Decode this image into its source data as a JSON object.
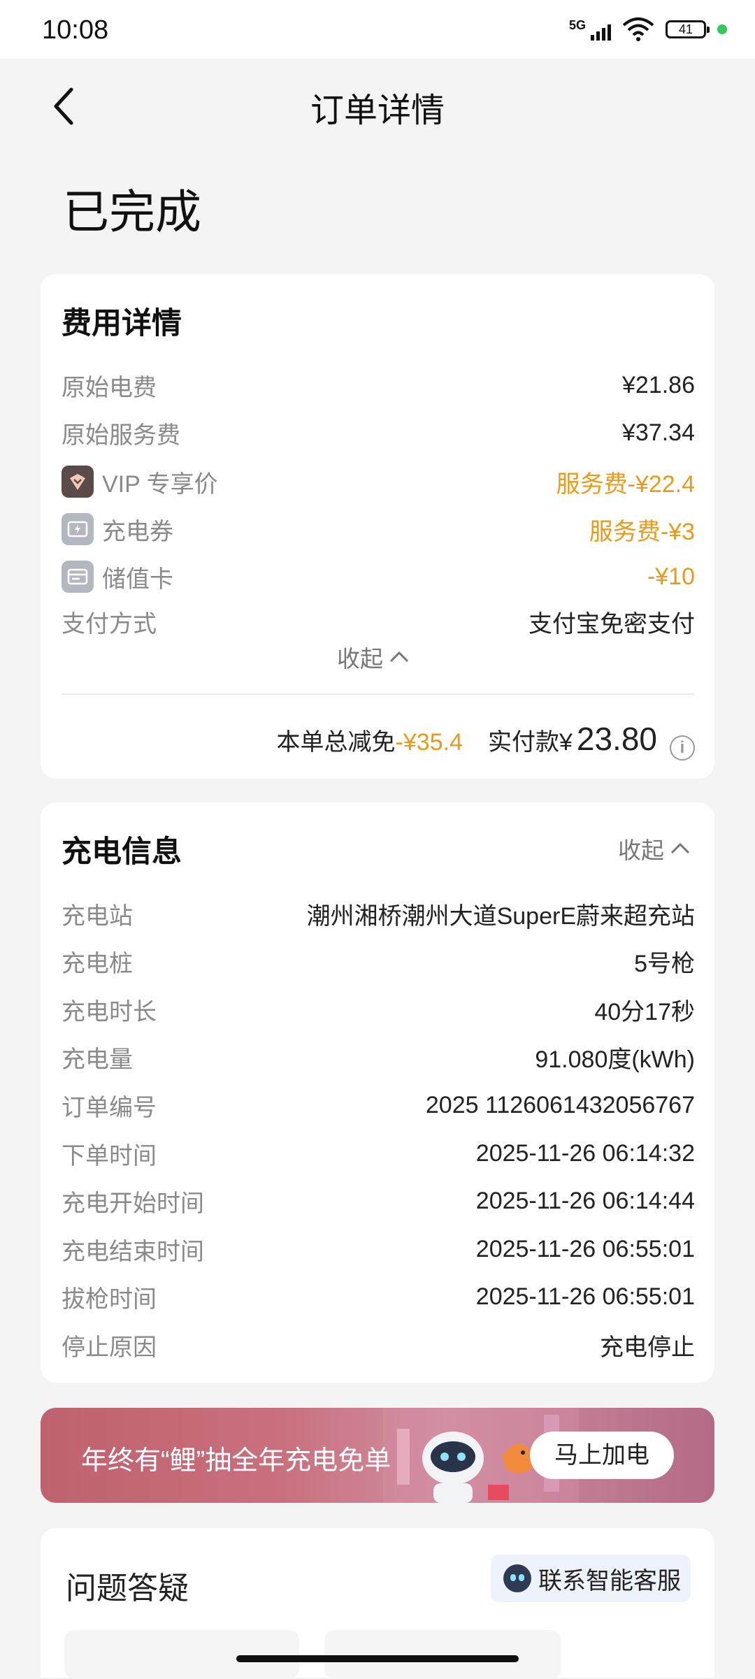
{
  "status_bar": {
    "time": "10:08",
    "network": "5G",
    "battery": "41"
  },
  "header": {
    "title": "订单详情"
  },
  "order_status": "已完成",
  "fees": {
    "title": "费用详情",
    "rows": [
      {
        "label": "原始电费",
        "value": "¥21.86"
      },
      {
        "label": "原始服务费",
        "value": "¥37.34"
      },
      {
        "label": "VIP 专享价",
        "value": "服务费-¥22.4",
        "icon": "vip-icon"
      },
      {
        "label": "充电券",
        "value": "服务费-¥3",
        "icon": "coupon-icon"
      },
      {
        "label": "储值卡",
        "value": "-¥10",
        "icon": "card-icon"
      },
      {
        "label": "支付方式",
        "value": "支付宝免密支付"
      }
    ],
    "collapse_label": "收起",
    "total_discount_label": "本单总减免",
    "total_discount_value": "-¥35.4",
    "paid_label": "实付款¥",
    "paid_value": "23.80"
  },
  "charging": {
    "title": "充电信息",
    "collapse_label": "收起",
    "rows": [
      {
        "label": "充电站",
        "value": "潮州湘桥潮州大道SuperE蔚来超充站"
      },
      {
        "label": "充电桩",
        "value": "5号枪"
      },
      {
        "label": "充电时长",
        "value": "40分17秒"
      },
      {
        "label": "充电量",
        "value": "91.080度(kWh)"
      },
      {
        "label": "订单编号",
        "value": "2025 1126061432056767"
      },
      {
        "label": "下单时间",
        "value": "2025-11-26 06:14:32"
      },
      {
        "label": "充电开始时间",
        "value": "2025-11-26 06:14:44"
      },
      {
        "label": "充电结束时间",
        "value": "2025-11-26 06:55:01"
      },
      {
        "label": "拔枪时间",
        "value": "2025-11-26 06:55:01"
      },
      {
        "label": "停止原因",
        "value": "充电停止"
      }
    ]
  },
  "banner": {
    "text": "年终有“鲤”抽全年充电免单",
    "button": "马上加电"
  },
  "qa": {
    "title": "问题答疑",
    "support_button": "联系智能客服"
  },
  "colors": {
    "accent_orange": "#e89a1c",
    "background": "#f4f4f4"
  }
}
